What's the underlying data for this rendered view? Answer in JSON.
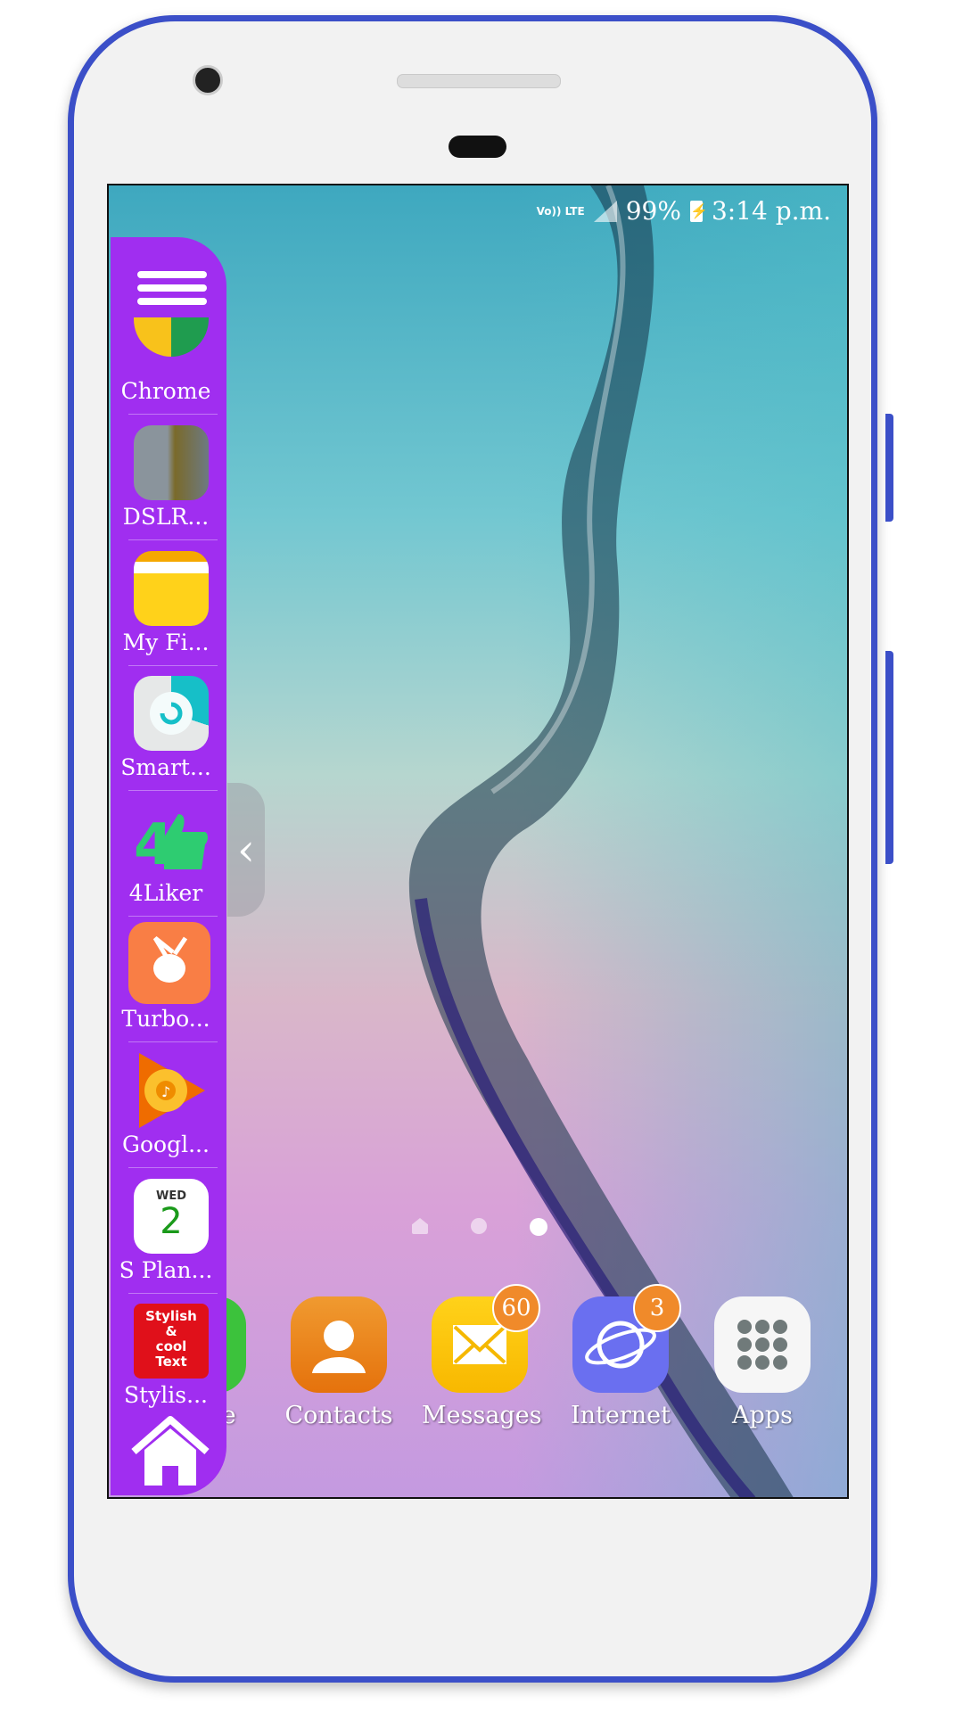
{
  "status_bar": {
    "network": "Vo)) LTE",
    "battery": "99%",
    "time": "3:14 p.m."
  },
  "sidebar": {
    "items": [
      {
        "label": "Chrome",
        "icon": "chrome-icon"
      },
      {
        "label": "DSLR...",
        "icon": "dslr-camera-icon"
      },
      {
        "label": "My Fi...",
        "icon": "folder-icon"
      },
      {
        "label": "Smart...",
        "icon": "smart-manager-icon"
      },
      {
        "label": "4Liker",
        "icon": "thumbs-up-icon"
      },
      {
        "label": "Turbo...",
        "icon": "turbo-vpn-icon"
      },
      {
        "label": "Googl...",
        "icon": "google-play-music-icon"
      },
      {
        "label": "S Plan...",
        "icon": "calendar-icon"
      },
      {
        "label": "Stylis...",
        "icon": "stylish-text-icon"
      }
    ],
    "calendar_day": "WED",
    "calendar_date": "2",
    "stylish_logo": "Stylish & cool Text",
    "color": "#a02ef0"
  },
  "dock": [
    {
      "label": "Phone",
      "icon": "phone-icon"
    },
    {
      "label": "Contacts",
      "icon": "contacts-icon"
    },
    {
      "label": "Messages",
      "icon": "messages-icon",
      "badge": "60"
    },
    {
      "label": "Internet",
      "icon": "internet-icon",
      "badge": "3"
    },
    {
      "label": "Apps",
      "icon": "apps-grid-icon"
    }
  ],
  "page_indicator": {
    "pages": 3,
    "current": 3
  },
  "phone_frame_color": "#3b4fc8"
}
